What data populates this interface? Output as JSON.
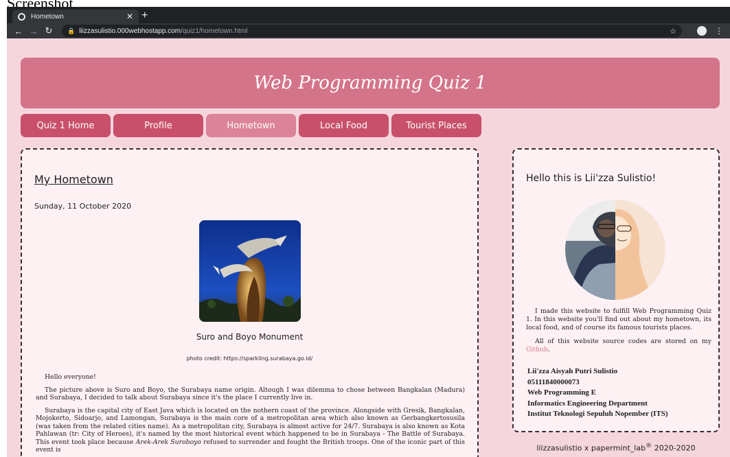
{
  "caption": "Screenshot",
  "browser": {
    "tab_title": "Hometown",
    "url_domain": "liizzasulistio.000webhostapp.com",
    "url_path": "/quiz1/hometown.html"
  },
  "site": {
    "title": "Web Programming Quiz 1",
    "nav": [
      {
        "label": "Quiz 1 Home"
      },
      {
        "label": "Profile"
      },
      {
        "label": "Hometown"
      },
      {
        "label": "Local Food"
      },
      {
        "label": "Tourist Places"
      }
    ],
    "active_nav": "Hometown",
    "accent_color": "#d4748b"
  },
  "post": {
    "title": "My Hometown",
    "date": "Sunday, 11 October 2020",
    "image_caption": "Suro and Boyo Monument",
    "photo_credit": "photo credit: https://sparkling.surabaya.go.id/",
    "p1": "Hello everyone!",
    "p2": "The picture above is Suro and Boyo, the Surabaya name origin. Altough I was dilemma to chose between Bangkalan (Madura) and Surabaya, I decided to talk about Surabaya since it's the place I currently live in.",
    "p3a": "Surabaya is the capital city of East Java which is located on the nothern coast of the province. Alongside with Gresik, Bangkalan, Mojokerto, Sidoarjo, and Lamongan, Surabaya is the main core of a metropolitan area which also known as Gerbangkertosusila (was taken from the related cities name). As a metropolitan city, Surabaya is almost active for 24/7. Surabaya is also known as Kota Pahlawan (tr: City of Heroes), it's named by the most historical event which happened to be in Surabaya - The Battle of Surabaya. This event took place because ",
    "p3_em": "Arek-Arek Suroboyo",
    "p3b": " refused to surrender and fought the British troops. One of the iconic part of this event is"
  },
  "sidebar": {
    "greeting": "Hello this is Lii'zza Sulistio!",
    "about1": "I made this website to fulfill Web Programming Quiz 1. In this website you'll find out about my hometown, its local food, and of course its famous tourists places.",
    "about2_prefix": "All of this website source codes are stored on my ",
    "about2_link": "Github",
    "about2_suffix": ".",
    "name": "Lii'zza Aisyah Putri Sulistio",
    "student_id": "05111840000073",
    "course": "Web Programming E",
    "department": "Informatics Engineering Department",
    "institute": "Institut Teknologi Sepuluh Nopember (ITS)"
  },
  "footer": {
    "text_before": "liizzasulistio x papermint_lab",
    "reg": "®",
    "text_after": " 2020-2020"
  }
}
